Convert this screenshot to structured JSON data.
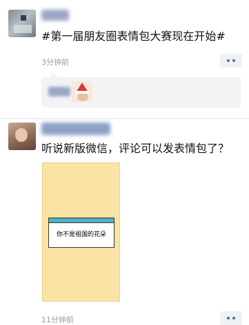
{
  "posts": [
    {
      "text": "#第一届朋友圈表情包大赛现在开始#",
      "time": "3分钟前",
      "comment": {
        "sticker_icon": "santa-hat-face-sticker"
      }
    },
    {
      "text": "听说新版微信，评论可以发表情包了？",
      "image": {
        "dialog_text": "你不是祖国的花朵"
      },
      "time": "11分钟前"
    }
  ],
  "icons": {
    "more": "ellipsis-icon"
  },
  "colors": {
    "timestamp": "#9b9b9b",
    "more_bg": "#eef1f5",
    "meme_bg": "#fbe3a6",
    "dialog_title": "#4fb3c4"
  }
}
